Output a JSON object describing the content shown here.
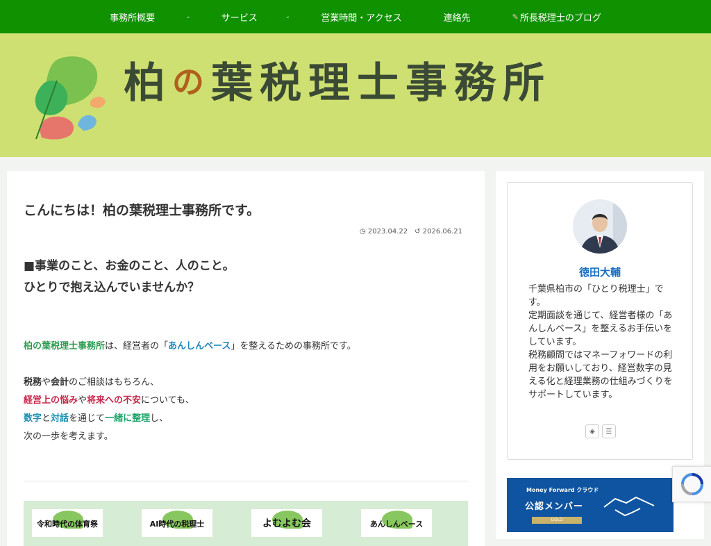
{
  "nav": {
    "items": [
      {
        "label": "事務所概要",
        "has_dropdown": true
      },
      {
        "label": "サービス",
        "has_dropdown": true
      },
      {
        "label": "営業時間・アクセス",
        "has_dropdown": false
      },
      {
        "label": "連絡先",
        "has_dropdown": false
      },
      {
        "label": "所長税理士のブログ",
        "has_dropdown": false,
        "icon": "pencil-icon"
      }
    ],
    "chevron": "⌄"
  },
  "header": {
    "logo_text_1": "柏",
    "logo_text_no": "の",
    "logo_text_2": "葉税理士事務所"
  },
  "post": {
    "title": "こんにちは！柏の葉税理士事務所です。",
    "published": "2023.04.22",
    "updated": "2026.06.21",
    "lead_line1": "■事業のこと、お金のこと、人のこと。",
    "lead_line2": "ひとりで抱え込んでいませんか？",
    "p1_a": "柏の葉税理士事務所",
    "p1_b": "は、経営者の「",
    "p1_c": "あんしんベース",
    "p1_d": "」を整えるための事務所です。",
    "p2_a": "税務",
    "p2_b": "や",
    "p2_c": "会計",
    "p2_d": "のご相談はもちろん、",
    "p3_a": "経営上の悩み",
    "p3_b": "や",
    "p3_c": "将来への不安",
    "p3_d": "についても、",
    "p4_a": "数字",
    "p4_b": "と",
    "p4_c": "対話",
    "p4_d": "を通じて",
    "p4_e": "一緒に整理",
    "p4_f": "し、",
    "p5": "次の一歩を考えます。"
  },
  "banners": [
    {
      "label": "令和時代の体育祭"
    },
    {
      "label": "AI時代の税理士"
    },
    {
      "label": "よむよむ会"
    },
    {
      "label": "あんしんベース"
    }
  ],
  "profile": {
    "name": "徳田大輔",
    "description": "千葉県柏市の「ひとり税理士」です。\n定期面談を通じて、経営者様の「あんしんベース」を整えるお手伝いをしています。\n税務顧問ではマネーフォワードの利用をお願いしており、経営数字の見える化と経理業務の仕組みづくりをサポートしています。"
  },
  "moneyforward": {
    "brand": "Money Forward クラウド",
    "title": "公認メンバー",
    "tier": "GOLD"
  },
  "colors": {
    "nav": "#0f9100",
    "header": "#cfe073",
    "name_link": "#1b6fc2"
  }
}
